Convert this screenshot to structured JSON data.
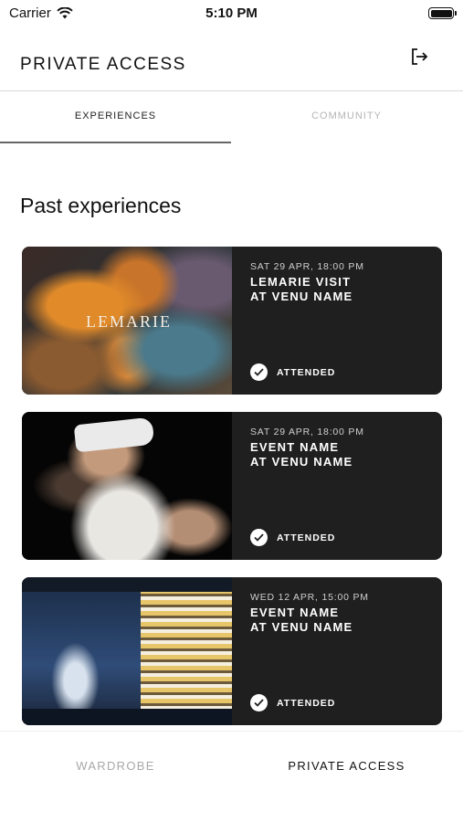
{
  "status_bar": {
    "carrier": "Carrier",
    "time": "5:10 PM"
  },
  "header": {
    "title": "PRIVATE ACCESS",
    "logout_icon": "logout-icon"
  },
  "tabs": [
    {
      "label": "EXPERIENCES",
      "active": true
    },
    {
      "label": "COMMUNITY",
      "active": false
    }
  ],
  "section_title": "Past experiences",
  "experiences": [
    {
      "image_text": "LEMARIE",
      "date": "SAT 29 APR, 18:00 PM",
      "name_line1": "LEMARIE VISIT",
      "name_line2": "AT VENU NAME",
      "status": "ATTENDED"
    },
    {
      "image_text": "",
      "date": "SAT 29 APR, 18:00 PM",
      "name_line1": "EVENT NAME",
      "name_line2": "AT VENU NAME",
      "status": "ATTENDED"
    },
    {
      "image_text": "",
      "date": "WED 12 APR, 15:00 PM",
      "name_line1": "EVENT NAME",
      "name_line2": "AT VENU NAME",
      "status": "ATTENDED"
    }
  ],
  "bottom_nav": [
    {
      "label": "WARDROBE",
      "active": false
    },
    {
      "label": "PRIVATE ACCESS",
      "active": true
    }
  ],
  "colors": {
    "card_bg": "#1f1f1f",
    "tab_indicator": "#666666",
    "inactive_text": "#b5b5b5"
  }
}
